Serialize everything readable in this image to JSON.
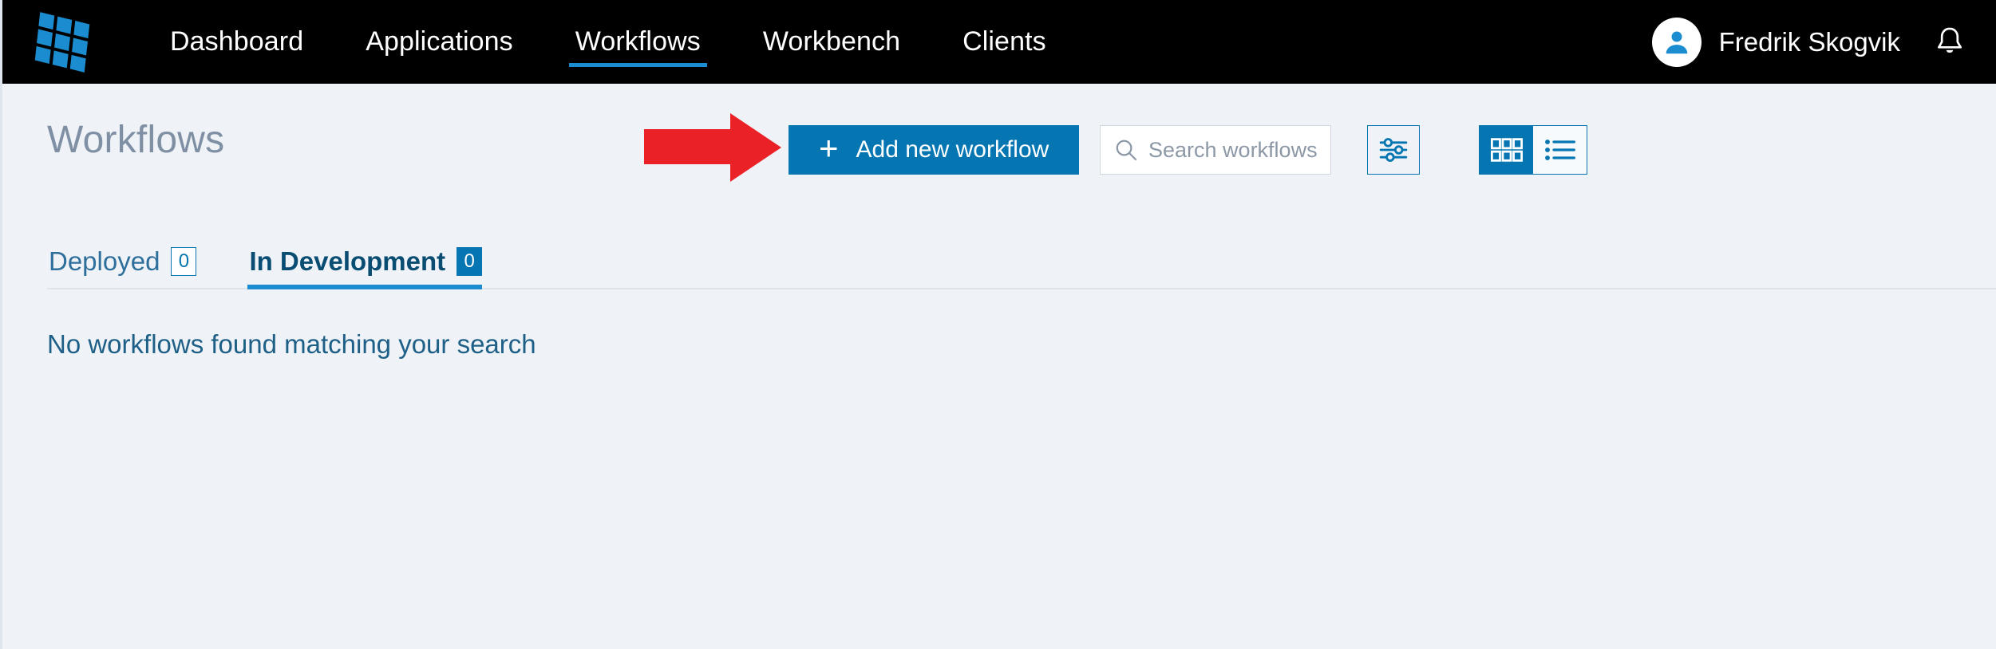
{
  "topnav": {
    "logo_name": "grid-logo",
    "items": [
      {
        "label": "Dashboard",
        "active": false
      },
      {
        "label": "Applications",
        "active": false
      },
      {
        "label": "Workflows",
        "active": true
      },
      {
        "label": "Workbench",
        "active": false
      },
      {
        "label": "Clients",
        "active": false
      }
    ],
    "user": {
      "name": "Fredrik Skogvik",
      "avatar_icon": "person-icon"
    },
    "notifications_icon": "bell-icon",
    "background_color": "#000000",
    "accent_color": "#1b8cd0"
  },
  "page": {
    "title": "Workflows"
  },
  "toolbar": {
    "add_button_label": "Add new workflow",
    "add_button_icon": "plus-icon",
    "add_button_color": "#0576b2",
    "search": {
      "placeholder": "Search workflows",
      "value": "",
      "icon": "search-icon"
    },
    "filter_button_icon": "sliders-filter-icon",
    "view_grid_icon": "grid-view-icon",
    "view_list_icon": "list-view-icon",
    "active_view": "grid"
  },
  "annotation": {
    "arrow_icon": "red-arrow-right-icon",
    "arrow_color": "#ea2127",
    "points_at": "Add new workflow"
  },
  "tabs": [
    {
      "label": "Deployed",
      "count": "0",
      "active": false
    },
    {
      "label": "In Development",
      "count": "0",
      "active": true
    }
  ],
  "main": {
    "empty_message": "No workflows found matching your search"
  }
}
